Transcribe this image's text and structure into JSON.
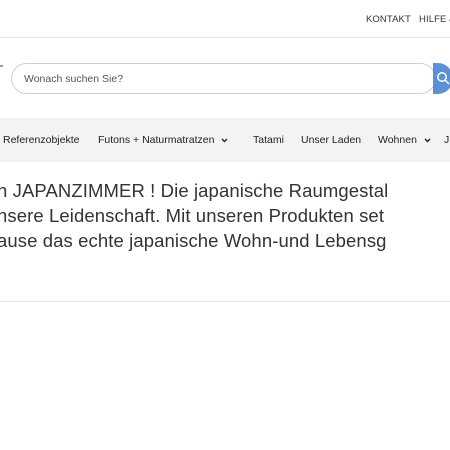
{
  "topbar": {
    "links": [
      {
        "label": "KONTAKT"
      },
      {
        "label": "HILFE &"
      }
    ]
  },
  "search": {
    "placeholder": "Wonach suchen Sie?",
    "button_icon": "search-icon",
    "button_color": "#5b8fd6"
  },
  "nav": {
    "items": [
      {
        "label": "Referenzobjekte",
        "has_dropdown": false
      },
      {
        "label": "Futons + Naturmatratzen",
        "has_dropdown": true
      },
      {
        "label": "Tatami",
        "has_dropdown": false
      },
      {
        "label": "Unser Laden",
        "has_dropdown": false
      },
      {
        "label": "Wohnen",
        "has_dropdown": true
      },
      {
        "label": "J",
        "has_dropdown": false
      }
    ],
    "background": "#f3f3f3"
  },
  "intro": {
    "lines": [
      "n JAPANZIMMER ! Die japanische Raumgestal",
      "nsere Leidenschaft. Mit unseren Produkten set",
      "ause das echte japanische Wohn-und Lebensg"
    ]
  }
}
